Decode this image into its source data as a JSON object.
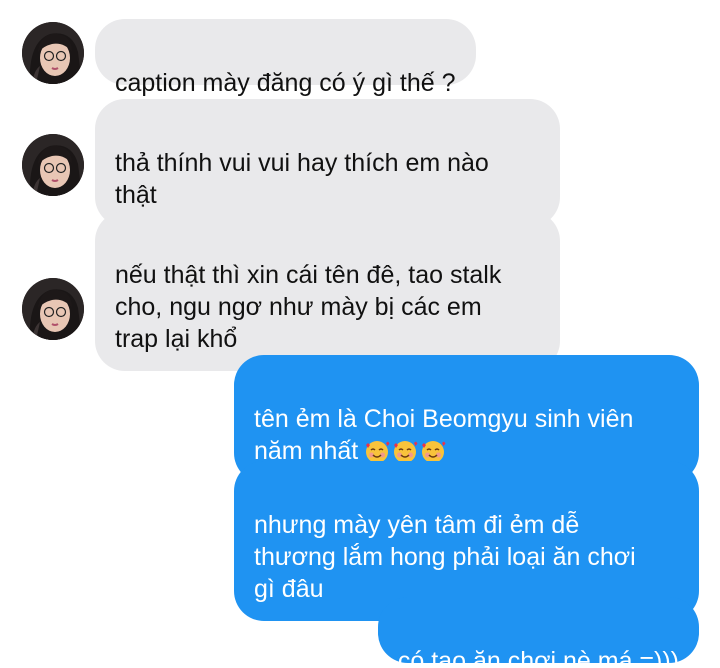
{
  "messages": [
    {
      "side": "incoming",
      "text": "caption mày đăng có ý gì thế ?"
    },
    {
      "side": "incoming",
      "text": "thả thính vui vui hay thích em nào\nthật"
    },
    {
      "side": "incoming",
      "text": "nếu thật thì xin cái tên đê, tao stalk\ncho, ngu ngơ như mày bị các em\ntrap lại khổ"
    },
    {
      "side": "outgoing",
      "text": "tên ẻm là Choi Beomgyu sinh viên\nnăm nhất",
      "emoji": "🥰🥰🥰"
    },
    {
      "side": "outgoing",
      "text": "nhưng mày yên tâm đi ẻm dễ\nthương lắm hong phải loại ăn chơi\ngì đâu"
    },
    {
      "side": "outgoing",
      "text": "có tao ăn chơi nè má =)))"
    }
  ],
  "colors": {
    "incoming_bubble": "#e9e9eb",
    "outgoing_bubble": "#1f93f2",
    "incoming_text": "#111111",
    "outgoing_text": "#ffffff"
  },
  "icons": {
    "avatar": "contact-avatar-photo",
    "reaction": "smiling-face-with-hearts-emoji"
  }
}
